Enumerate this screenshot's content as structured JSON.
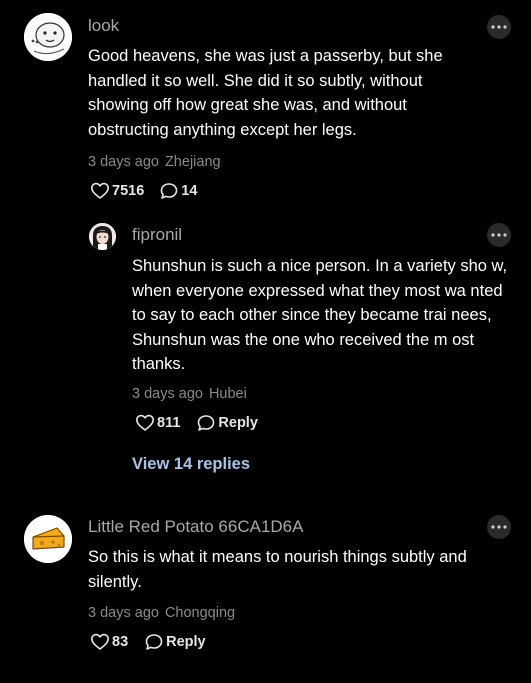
{
  "comments": [
    {
      "username": "look",
      "text": "Good heavens, she was just a passerby, but she handled it so well. She did it so subtly, without showing off how great she was, and without obstructing anything except her legs.",
      "time": "3 days ago",
      "location": "Zhejiang",
      "likes": "7516",
      "replies": "14",
      "more_icon": "more-icon"
    },
    {
      "username": "fipronil",
      "text": "Shunshun is such a nice person. In a variety sho w, when everyone expressed what they most wa nted to say to each other since they became trai nees, Shunshun was the one who received the m ost thanks.",
      "time": "3 days ago",
      "location": "Hubei",
      "likes": "811",
      "reply_label": "Reply",
      "more_icon": "more-icon"
    },
    {
      "username": "Little Red Potato 66CA1D6A",
      "text": "So this is what it means to nourish things subtly and silently.",
      "time": "3 days ago",
      "location": "Chongqing",
      "likes": "83",
      "reply_label": "Reply",
      "more_icon": "more-icon"
    }
  ],
  "view_replies": "View 14 replies",
  "colors": {
    "background": "#000000",
    "username": "#a8a8a8",
    "meta": "#8a8a8a",
    "link": "#a7c3e6"
  }
}
